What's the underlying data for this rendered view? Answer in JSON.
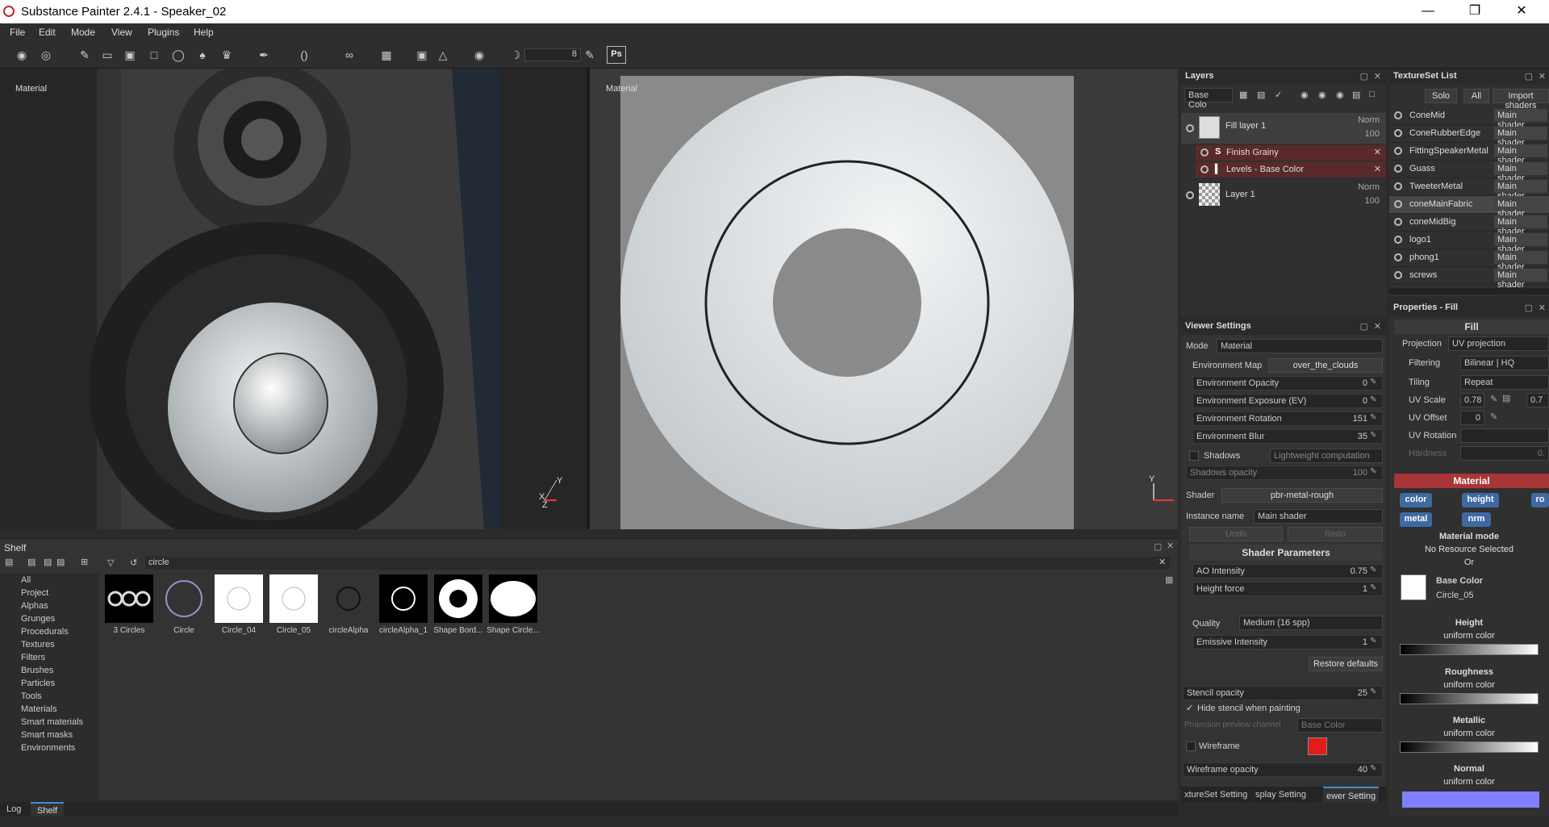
{
  "window": {
    "title": "Substance Painter 2.4.1 - Speaker_02",
    "minimize": "—",
    "restore": "❐",
    "close": "✕"
  },
  "menu": [
    "File",
    "Edit",
    "Mode",
    "View",
    "Plugins",
    "Help"
  ],
  "toolbar": {
    "brush_size": "8",
    "ps_label": "Ps"
  },
  "viewport3d": {
    "label": "Material",
    "axis_x": "X",
    "axis_y": "Y",
    "axis_z": "Z"
  },
  "viewport2d": {
    "label": "Material",
    "axis_y": "Y"
  },
  "layers": {
    "title": "Layers",
    "channel": "Base Colo",
    "items": [
      {
        "name": "Fill layer 1",
        "blend": "Norm",
        "opacity": "100"
      },
      {
        "name": "Finish Grainy"
      },
      {
        "name": "Levels - Base Color"
      },
      {
        "name": "Layer 1",
        "blend": "Norm",
        "opacity": "100"
      }
    ]
  },
  "texset": {
    "title": "TextureSet List",
    "solo": "Solo",
    "all": "All",
    "import": "Import shaders",
    "items": [
      {
        "name": "ConeMid",
        "shader": "Main shader"
      },
      {
        "name": "ConeRubberEdge",
        "shader": "Main shader"
      },
      {
        "name": "FittingSpeakerMetal",
        "shader": "Main shader"
      },
      {
        "name": "Guass",
        "shader": "Main shader"
      },
      {
        "name": "TweeterMetal",
        "shader": "Main shader"
      },
      {
        "name": "coneMainFabric",
        "shader": "Main shader"
      },
      {
        "name": "coneMidBig",
        "shader": "Main shader"
      },
      {
        "name": "logo1",
        "shader": "Main shader"
      },
      {
        "name": "phong1",
        "shader": "Main shader"
      },
      {
        "name": "screws",
        "shader": "Main shader"
      }
    ]
  },
  "viewer": {
    "title": "Viewer Settings",
    "mode_label": "Mode",
    "mode": "Material",
    "envmap_label": "Environment Map",
    "envmap": "over_the_clouds",
    "env_opacity": {
      "label": "Environment Opacity",
      "value": "0"
    },
    "env_exposure": {
      "label": "Environment Exposure (EV)",
      "value": "0"
    },
    "env_rotation": {
      "label": "Environment Rotation",
      "value": "151"
    },
    "env_blur": {
      "label": "Environment Blur",
      "value": "35"
    },
    "shadows": "Shadows",
    "shadows_mode": "Lightweight computation",
    "shadows_opacity": {
      "label": "Shadows opacity",
      "value": "100"
    },
    "shader_label": "Shader",
    "shader": "pbr-metal-rough",
    "instance_label": "Instance name",
    "instance": "Main shader",
    "undo": "Undo",
    "redo": "Redo",
    "shader_params": "Shader Parameters",
    "ao": {
      "label": "AO Intensity",
      "value": "0.75"
    },
    "height_force": {
      "label": "Height force",
      "value": "1"
    },
    "quality_label": "Quality",
    "quality": "Medium (16 spp)",
    "emissive": {
      "label": "Emissive Intensity",
      "value": "1"
    },
    "restore": "Restore defaults",
    "stencil": {
      "label": "Stencil opacity",
      "value": "25"
    },
    "hide_stencil": "Hide stencil when painting",
    "proj_preview": "Projection preview channel",
    "proj_channel": "Base Color",
    "wireframe": "Wireframe",
    "wireframe_color": "#e21b1b",
    "wire_opacity": {
      "label": "Wireframe opacity",
      "value": "40"
    },
    "tabs": [
      "xtureSet Setting",
      "splay Setting",
      "ewer Setting"
    ]
  },
  "props": {
    "title": "Properties - Fill",
    "fill": "Fill",
    "projection_label": "Projection",
    "projection": "UV projection",
    "filtering_label": "Filtering",
    "filtering": "Bilinear | HQ",
    "tiling_label": "Tiling",
    "tiling": "Repeat",
    "uvscale_label": "UV Scale",
    "uvscale": "0.78",
    "uvscale2": "0.7",
    "uvoffset_label": "UV Offset",
    "uvoffset": "0",
    "uvrot_label": "UV Rotation",
    "hardness_label": "Hardness",
    "hardness": "0.",
    "material": "Material",
    "chips": [
      "color",
      "height",
      "ro",
      "metal",
      "nrm"
    ],
    "material_mode": "Material mode",
    "no_resource": "No Resource Selected",
    "or": "Or",
    "base_color": "Base Color",
    "base_color_res": "Circle_05",
    "height": "Height",
    "height_sub": "uniform color",
    "roughness": "Roughness",
    "roughness_sub": "uniform color",
    "metallic": "Metallic",
    "metallic_sub": "uniform color",
    "normal": "Normal",
    "normal_sub": "uniform color",
    "normal_color": "#8080ff",
    "grad_ticks_h": [
      "-0.6",
      "-0.2",
      "0.2",
      "0.6"
    ],
    "grad_ticks": [
      "0.2",
      "0.4",
      "0.6",
      "0.8"
    ]
  },
  "shelf": {
    "title": "Shelf",
    "search": "circle",
    "categories": [
      "All",
      "Project",
      "Alphas",
      "Grunges",
      "Procedurals",
      "Textures",
      "Filters",
      "Brushes",
      "Particles",
      "Tools",
      "Materials",
      "Smart materials",
      "Smart masks",
      "Environments"
    ],
    "items": [
      "3 Circles",
      "Circle",
      "Circle_04",
      "Circle_05",
      "circleAlpha",
      "circleAlpha_1",
      "Shape Bord...",
      "Shape Circle..."
    ]
  },
  "bottom_tabs": [
    "Log",
    "Shelf"
  ]
}
